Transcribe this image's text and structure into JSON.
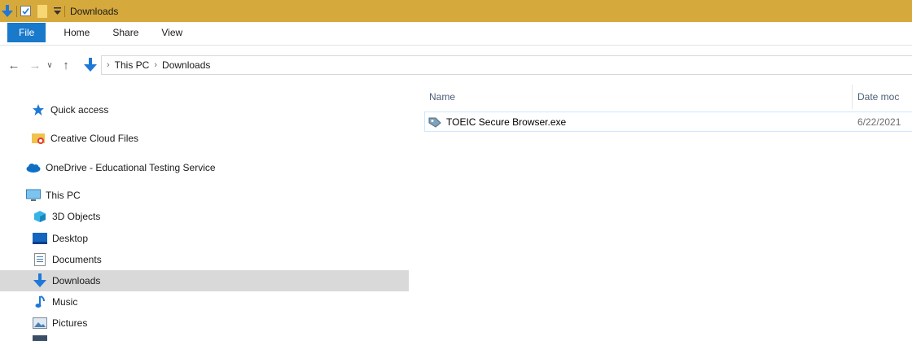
{
  "window": {
    "title": "Downloads"
  },
  "ribbon": {
    "tabs": [
      "File",
      "Home",
      "Share",
      "View"
    ]
  },
  "address": {
    "crumbs": [
      "This PC",
      "Downloads"
    ]
  },
  "nav_pane": {
    "items": [
      {
        "label": "Quick access",
        "icon": "star-icon"
      },
      {
        "label": "Creative Cloud Files",
        "icon": "creative-cloud-folder-icon"
      },
      {
        "label": "OneDrive - Educational Testing Service",
        "icon": "onedrive-cloud-icon"
      },
      {
        "label": "This PC",
        "icon": "this-pc-icon"
      },
      {
        "label": "3D Objects",
        "icon": "3d-objects-icon"
      },
      {
        "label": "Desktop",
        "icon": "desktop-icon"
      },
      {
        "label": "Documents",
        "icon": "documents-icon"
      },
      {
        "label": "Downloads",
        "icon": "downloads-arrow-icon",
        "selected": true
      },
      {
        "label": "Music",
        "icon": "music-note-icon"
      },
      {
        "label": "Pictures",
        "icon": "pictures-icon"
      }
    ]
  },
  "content": {
    "columns": {
      "name": "Name",
      "date": "Date moc"
    },
    "files": [
      {
        "name": "TOEIC Secure Browser.exe",
        "date": "6/22/2021",
        "icon": "exe-tag-icon"
      }
    ]
  },
  "colors": {
    "titlebar": "#d6a93c",
    "file_tab": "#1979ca",
    "selection": "#d9d9d9",
    "row_border": "#cce8ff"
  }
}
